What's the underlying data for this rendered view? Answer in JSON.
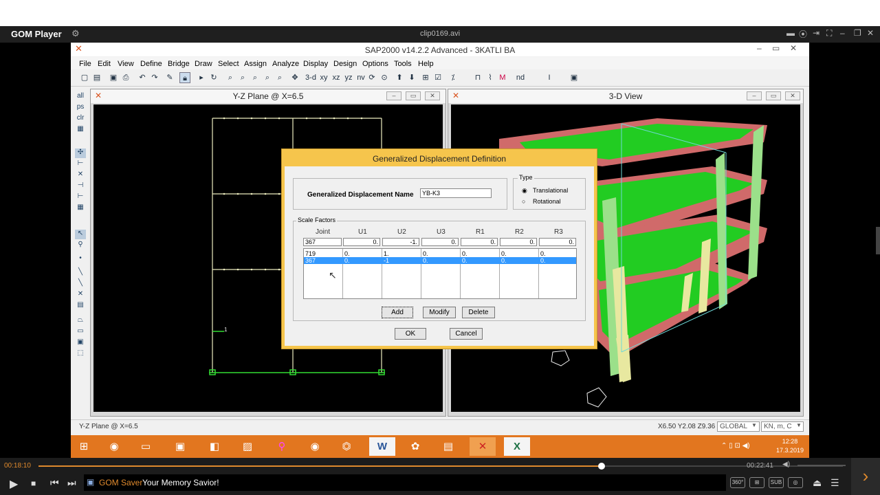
{
  "player": {
    "name": "GOM Player",
    "file": "clip0169.avi",
    "time_current": "00:18:10",
    "time_total": "00:22:41",
    "progress": 0.7,
    "saver_label": "GOM Saver",
    "saver_text": "Your Memory Savior!",
    "badge_360": "360°",
    "badge_sub": "SUB"
  },
  "sap": {
    "title": "SAP2000 v14.2.2 Advanced  - 3KATLI BA",
    "menu": [
      "File",
      "Edit",
      "View",
      "Define",
      "Bridge",
      "Draw",
      "Select",
      "Assign",
      "Analyze",
      "Display",
      "Design",
      "Options",
      "Tools",
      "Help"
    ],
    "toolbar_labels": [
      "3-d",
      "xy",
      "xz",
      "yz",
      "nv",
      "nd"
    ],
    "left_labels": [
      "all",
      "ps",
      "clr"
    ],
    "left_window_title": "Y-Z Plane @ X=6.5",
    "right_window_title": "3-D View",
    "status_left": "Y-Z Plane @ X=6.5",
    "status_coords": "X6.50  Y2.08  Z9.36",
    "coord_system": "GLOBAL",
    "units": "KN, m, C",
    "frame_label": "1",
    "clock_time": "12:28",
    "clock_date": "17.3.2019"
  },
  "dialog": {
    "title": "Generalized Displacement Definition",
    "name_label": "Generalized Displacement Name",
    "name_value": "YB-K3",
    "type_group": "Type",
    "type_options": [
      "Translational",
      "Rotational"
    ],
    "selected_type": "Translational",
    "scale_group": "Scale Factors",
    "columns": [
      "Joint",
      "U1",
      "U2",
      "U3",
      "R1",
      "R2",
      "R3"
    ],
    "edit_row": [
      "367",
      "0.",
      "-1.",
      "0.",
      "0.",
      "0.",
      "0."
    ],
    "rows": [
      [
        "719",
        "0.",
        "1.",
        "0.",
        "0.",
        "0.",
        "0."
      ],
      [
        "367",
        "0.",
        "-1",
        "0.",
        "0.",
        "0.",
        "0."
      ]
    ],
    "selected_row": 1,
    "add_label": "Add",
    "modify_label": "Modify",
    "delete_label": "Delete",
    "ok_label": "OK",
    "cancel_label": "Cancel"
  },
  "colors": {
    "accent": "#e08a2d",
    "selection": "#3399ff",
    "dialog_border": "#f6c54c",
    "taskbar": "#e2761f",
    "slab_green": "#22cc22",
    "beam_red": "#d06a6a"
  }
}
